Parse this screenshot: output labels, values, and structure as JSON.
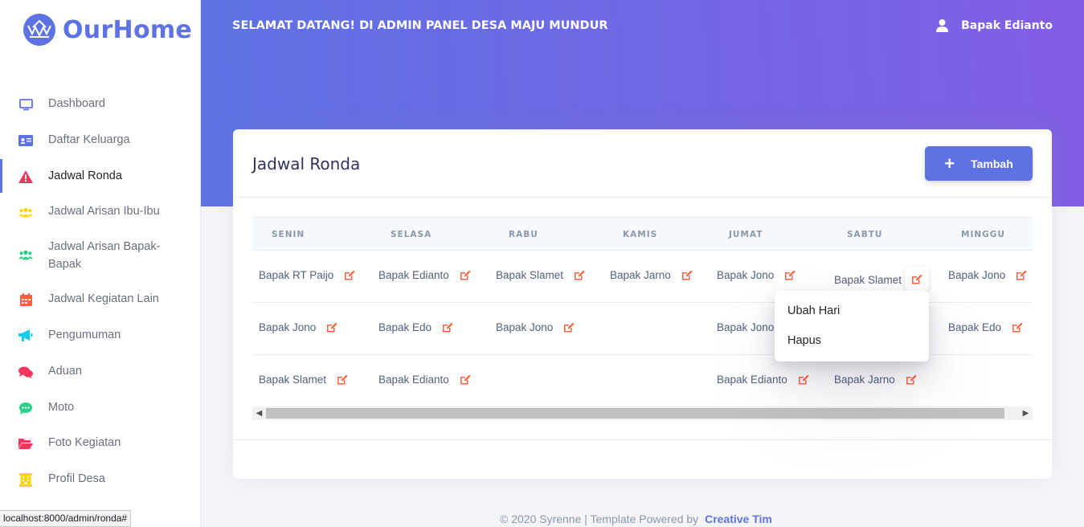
{
  "brand": {
    "name": "OurHome"
  },
  "sidebar": {
    "items": [
      {
        "label": "Dashboard",
        "icon": "monitor-icon",
        "color": "#5e72e4"
      },
      {
        "label": "Daftar Keluarga",
        "icon": "id-card-icon",
        "color": "#5e72e4"
      },
      {
        "label": "Jadwal Ronda",
        "icon": "warning-icon",
        "color": "#f5365c",
        "active": true
      },
      {
        "label": "Jadwal Arisan Ibu-Ibu",
        "icon": "users-icon",
        "color": "#ffd600"
      },
      {
        "label": "Jadwal Arisan Bapak-Bapak",
        "icon": "users-icon",
        "color": "#2dce89"
      },
      {
        "label": "Jadwal Kegiatan Lain",
        "icon": "calendar-icon",
        "color": "#fb6340"
      },
      {
        "label": "Pengumuman",
        "icon": "bullhorn-icon",
        "color": "#11cdef"
      },
      {
        "label": "Aduan",
        "icon": "comments-icon",
        "color": "#f5365c"
      },
      {
        "label": "Moto",
        "icon": "comment-dots-icon",
        "color": "#2dce89"
      },
      {
        "label": "Foto Kegiatan",
        "icon": "folder-open-icon",
        "color": "#f5365c"
      },
      {
        "label": "Profil Desa",
        "icon": "building-icon",
        "color": "#ffd600"
      }
    ]
  },
  "header": {
    "welcome": "SELAMAT DATANG! DI ADMIN PANEL DESA MAJU MUNDUR",
    "user": "Bapak Edianto"
  },
  "card": {
    "title": "Jadwal Ronda",
    "add_button": "Tambah"
  },
  "table": {
    "headers": [
      "SENIN",
      "SELASA",
      "RABU",
      "KAMIS",
      "JUMAT",
      "SABTU",
      "MINGGU"
    ],
    "rows": [
      [
        "Bapak RT Paijo",
        "Bapak Edianto",
        "Bapak Slamet",
        "Bapak Jarno",
        "Bapak Jono",
        "Bapak Slamet",
        "Bapak Jono"
      ],
      [
        "Bapak Jono",
        "Bapak Edo",
        "Bapak Jono",
        "",
        "Bapak Jono",
        "",
        "Bapak Edo"
      ],
      [
        "Bapak Slamet",
        "Bapak Edianto",
        "",
        "",
        "Bapak Edianto",
        "Bapak Jarno",
        ""
      ]
    ]
  },
  "dropdown": {
    "items": [
      "Ubah Hari",
      "Hapus"
    ]
  },
  "footer": {
    "text": "© 2020 Syrenne | Template Powered by",
    "link": "Creative Tim"
  },
  "statusbar": {
    "url": "localhost:8000/admin/ronda#"
  },
  "colors": {
    "accent": "#5e72e4",
    "accent2": "#825ee4",
    "edit": "#fb6340"
  }
}
